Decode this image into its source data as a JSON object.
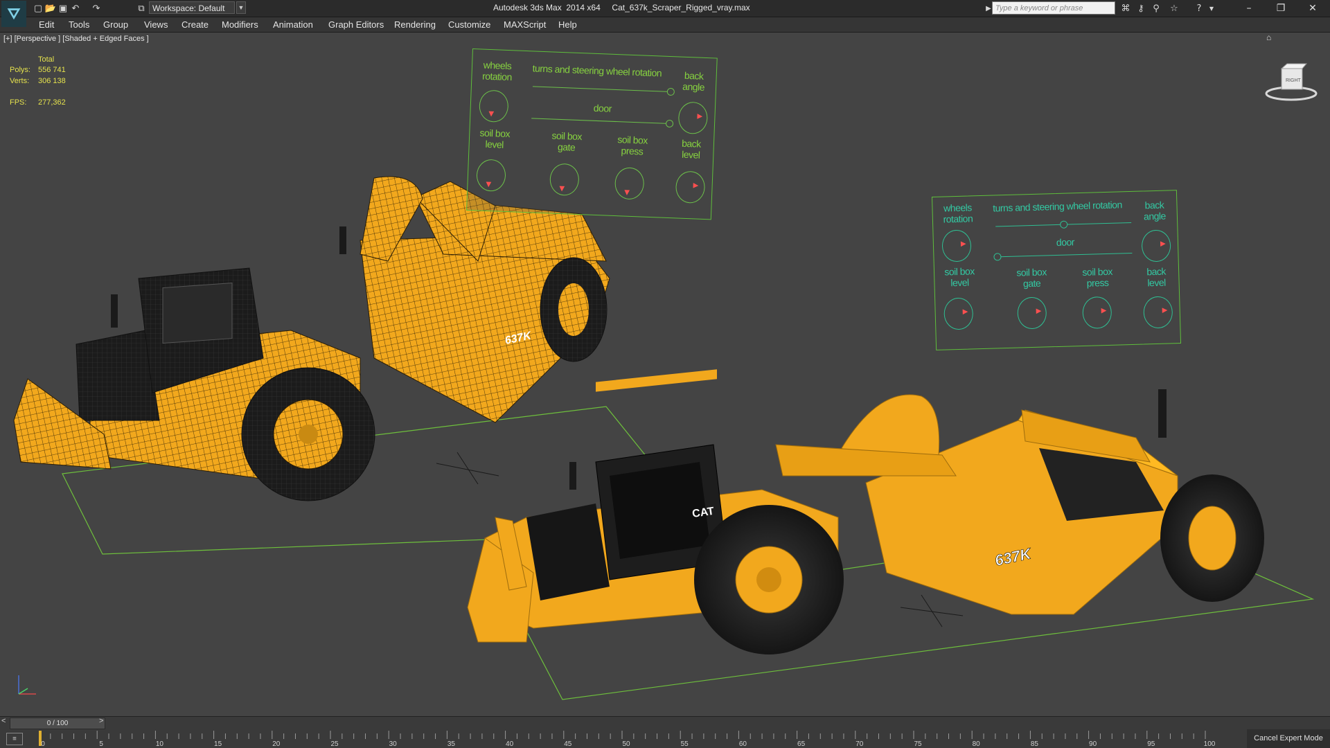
{
  "titlebar": {
    "workspace": "Workspace: Default",
    "window_title": "Autodesk 3ds Max  2014 x64     Cat_637k_Scraper_Rigged_vray.max",
    "search_placeholder": "Type a keyword or phrase",
    "logo_glyph": "⛛",
    "quick_access_icons": [
      "new-file-icon",
      "open-folder-icon",
      "save-icon",
      "undo-icon",
      "redo-icon",
      "project-folder-icon"
    ],
    "help_icons": [
      "binoculars-icon",
      "key-icon",
      "search-tools-icon",
      "star-icon",
      "help-icon"
    ],
    "window_buttons": {
      "minimize": "–",
      "restore": "❐",
      "close": "✕"
    }
  },
  "menu": [
    "Edit",
    "Tools",
    "Group",
    "Views",
    "Create",
    "Modifiers",
    "Animation",
    "Graph Editors",
    "Rendering",
    "Customize",
    "MAXScript",
    "Help"
  ],
  "viewport": {
    "label": "[+] [Perspective ] [Shaded + Edged Faces ]",
    "stats": {
      "total_label": "Total",
      "polys_label": "Polys:",
      "polys_value": "556 741",
      "verts_label": "Verts:",
      "verts_value": "306 138",
      "fps_label": "FPS:",
      "fps_value": "277,362"
    },
    "viewcube_label": "RIGHT",
    "colors": {
      "background": "#444444",
      "vehicle_yellow": "#f2a81d",
      "panel_green": "#86d140",
      "panel_teal": "#33c9a3",
      "stats_yellow": "#e6e34d",
      "ground_line": "#6ec03c"
    }
  },
  "control_panels": [
    {
      "name": "panel-1",
      "labels": {
        "wheels_rotation": "wheels\nrotation",
        "turns": "turns and steering wheel rotation",
        "back_angle": "back\nangle",
        "door": "door",
        "soil_box_level": "soil box\nlevel",
        "soil_box_gate": "soil box\ngate",
        "soil_box_press": "soil box\npress",
        "back_level": "back\nlevel"
      }
    },
    {
      "name": "panel-2",
      "labels": {
        "wheels_rotation": "wheels\nrotation",
        "turns": "turns and steering wheel rotation",
        "back_angle": "back\nangle",
        "door": "door",
        "soil_box_level": "soil box\nlevel",
        "soil_box_gate": "soil box\ngate",
        "soil_box_press": "soil box\npress",
        "back_level": "back\nlevel"
      }
    }
  ],
  "vehicle_labels": {
    "wireframe_model": "637K",
    "shaded_model": "637K",
    "brand": "CAT"
  },
  "timeline": {
    "frame": "0 / 100",
    "prev": "<",
    "next": ">",
    "ticks": [
      "0",
      "5",
      "10",
      "15",
      "20",
      "25",
      "30",
      "35",
      "40",
      "45",
      "50",
      "55",
      "60",
      "65",
      "70",
      "75",
      "80",
      "85",
      "90",
      "95",
      "100"
    ]
  },
  "status": {
    "cancel_expert_mode": "Cancel Expert Mode"
  }
}
